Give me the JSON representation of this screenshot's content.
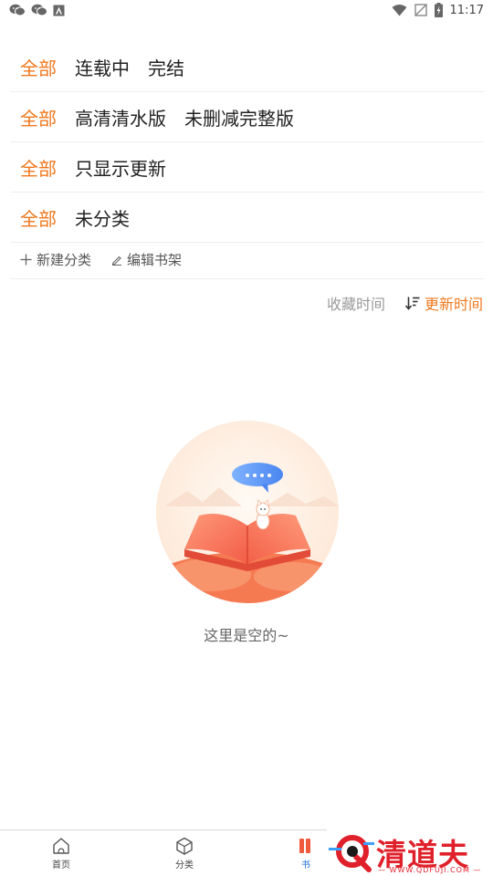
{
  "status_bar": {
    "time": "11:17",
    "left_icons": [
      "wechat-icon",
      "wechat-icon",
      "app-icon"
    ],
    "right_icons": [
      "wifi-icon",
      "no-sim-icon",
      "battery-charging-icon"
    ]
  },
  "filters": [
    {
      "active": "全部",
      "options": [
        "连载中",
        "完结"
      ]
    },
    {
      "active": "全部",
      "options": [
        "高清清水版",
        "未删减完整版"
      ]
    },
    {
      "active": "全部",
      "options": [
        "只显示更新"
      ]
    },
    {
      "active": "全部",
      "options": [
        "未分类"
      ]
    }
  ],
  "actions": {
    "new_category": "新建分类",
    "edit_shelf": "编辑书架"
  },
  "sort": {
    "option": "收藏时间",
    "active": "更新时间"
  },
  "empty": {
    "text": "这里是空的~"
  },
  "bottom_nav": {
    "items": [
      {
        "label": "首页",
        "icon": "home-icon"
      },
      {
        "label": "分类",
        "icon": "box-icon"
      },
      {
        "label": "书",
        "icon": "bookshelf-icon"
      }
    ]
  },
  "watermark": {
    "text": "清道夫",
    "url": "— WWW.QDFUJI.COM —"
  },
  "colors": {
    "accent": "#f0781e",
    "nav_active": "#1f6fd1",
    "watermark": "#e0202a"
  }
}
